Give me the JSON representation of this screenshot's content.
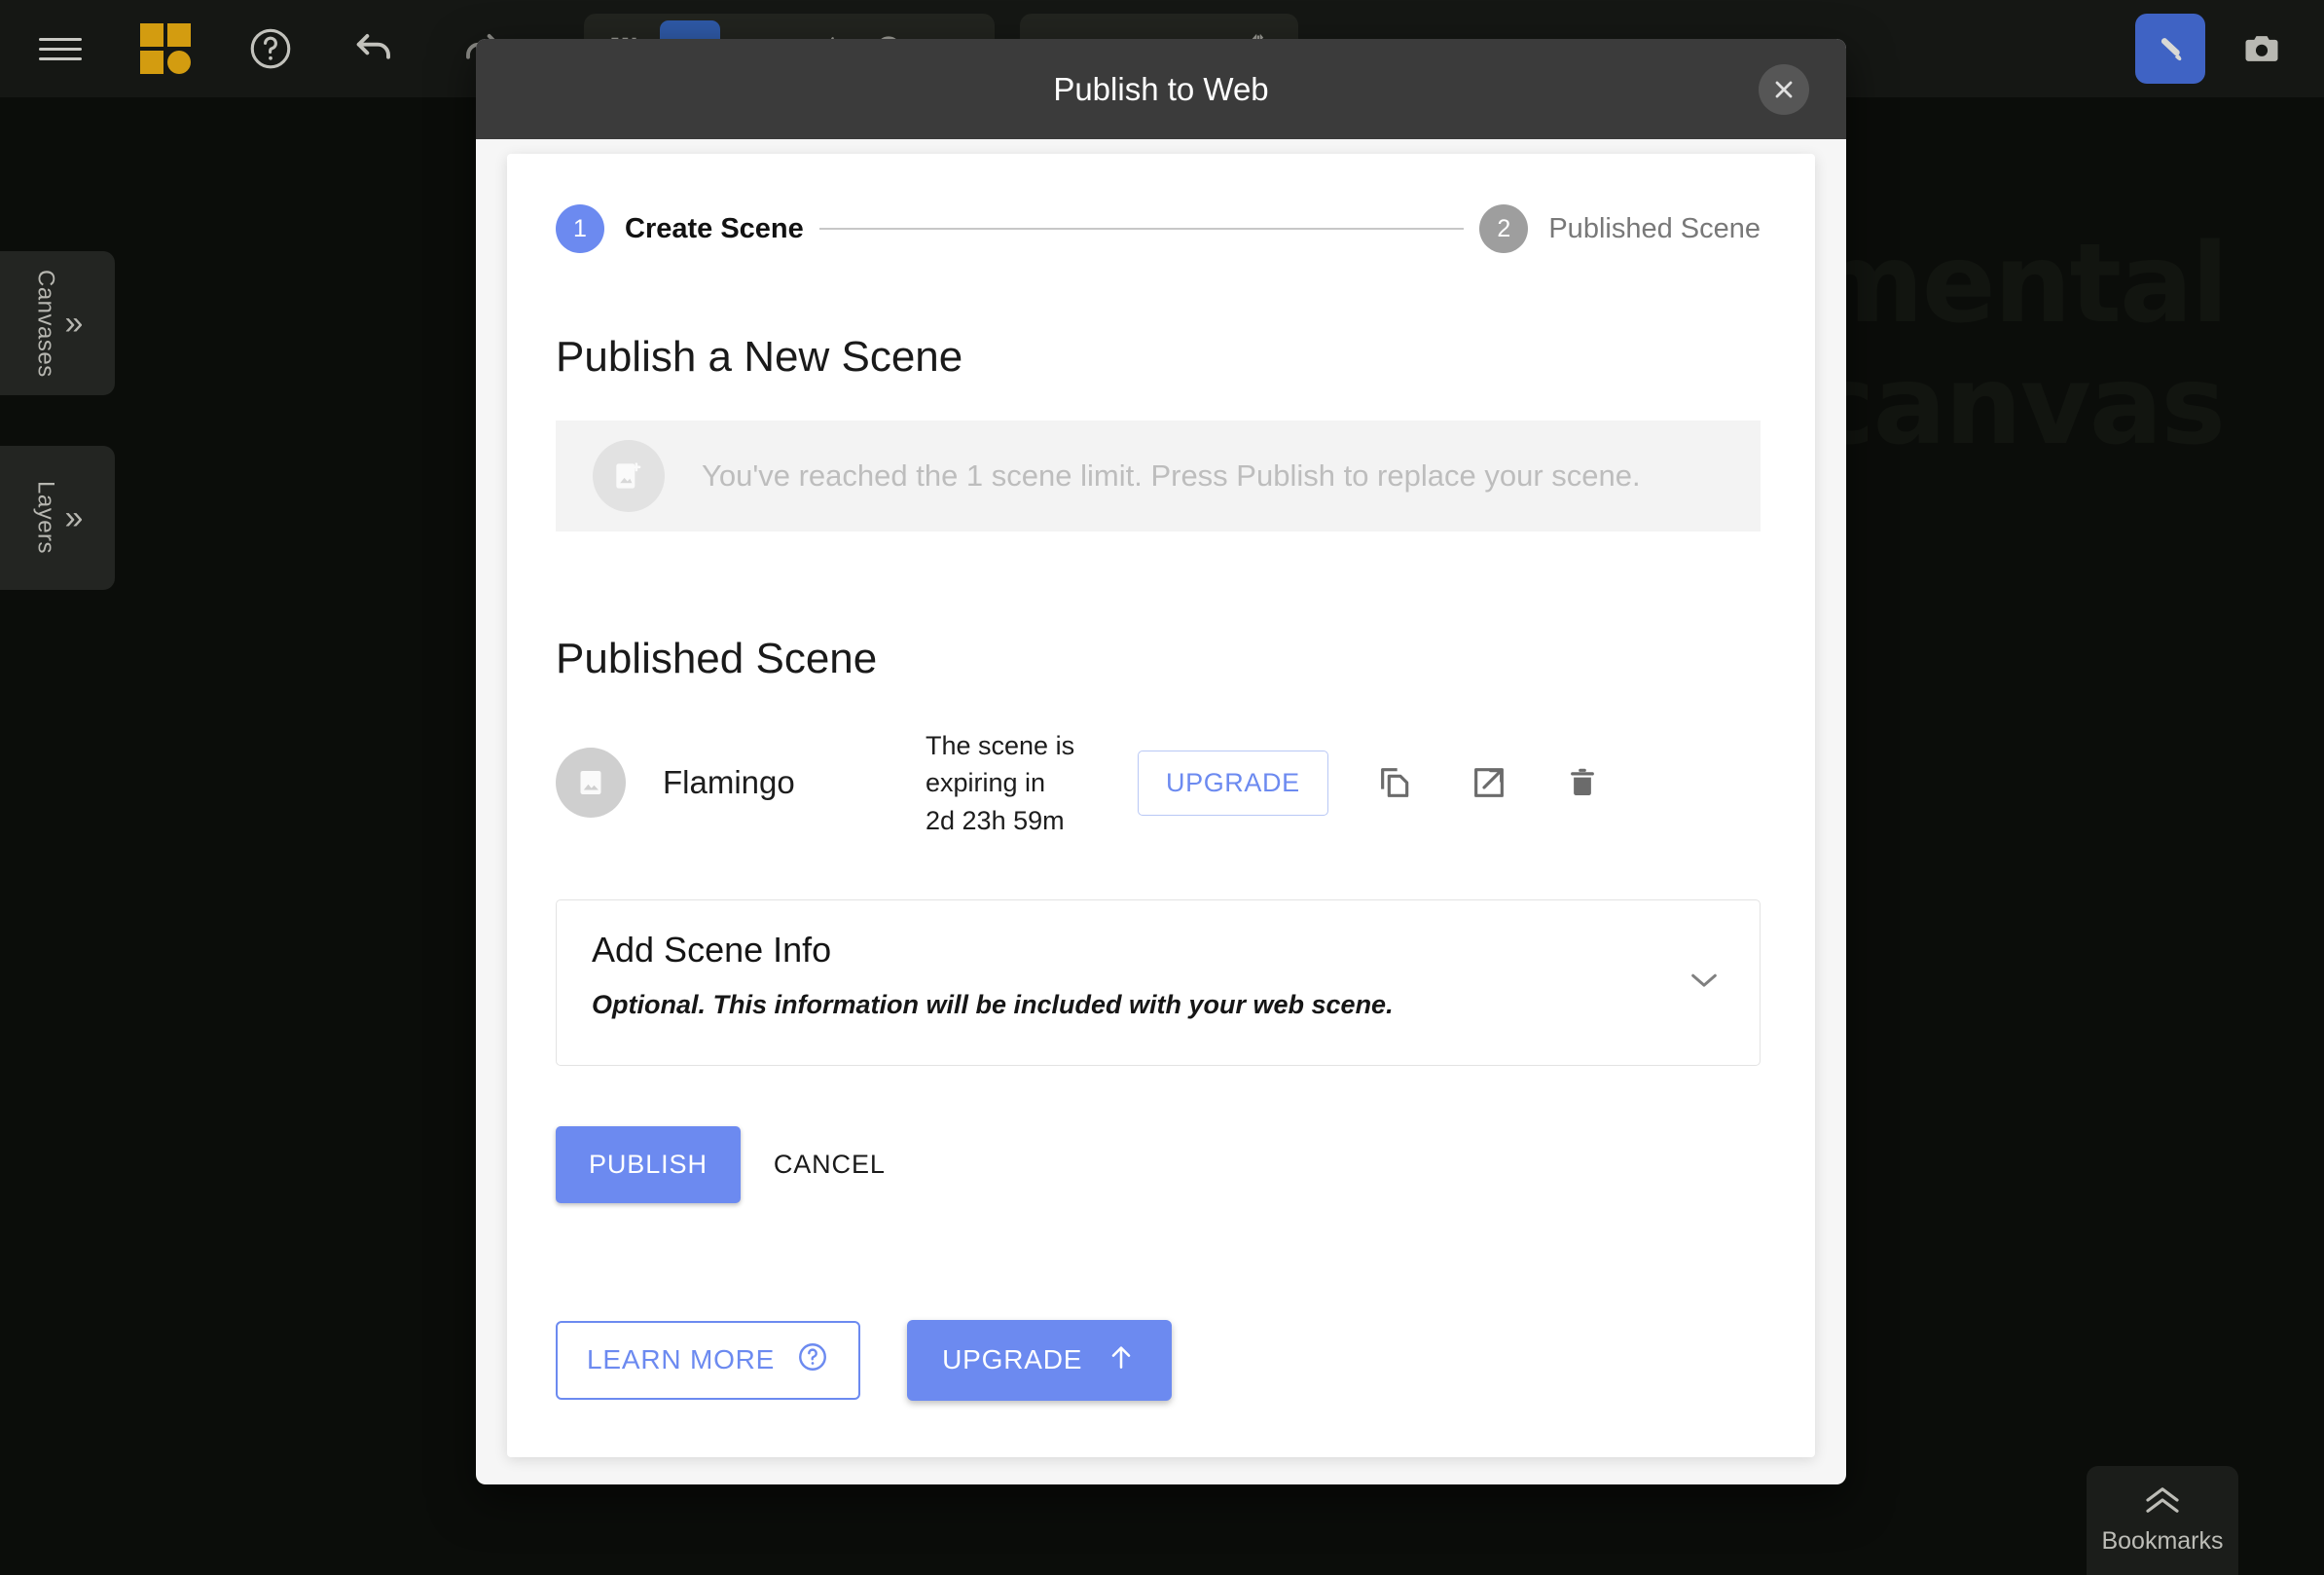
{
  "app": {
    "canvas_backdrop_lines": [
      "mental",
      "canvas"
    ]
  },
  "toolbar": {
    "menu_icon": "hamburger-menu-icon",
    "logo_icon": "mental-canvas-logo-icon",
    "help_icon": "help-circle-icon",
    "undo_icon": "undo-arrow-icon",
    "redo_icon": "redo-arrow-icon",
    "tools": [
      {
        "name": "select-tool",
        "icon": "dashed-rect-icon",
        "active": false
      },
      {
        "name": "draw-tool",
        "icon": "scribble-icon",
        "active": true
      },
      {
        "name": "fill-tool",
        "icon": "triangle-fill-icon",
        "active": false
      },
      {
        "name": "polyline-tool",
        "icon": "polyline-icon",
        "active": false
      },
      {
        "name": "lasso-tool",
        "icon": "circle-outline-icon",
        "active": false
      },
      {
        "name": "frame-tool",
        "icon": "rounded-rect-icon",
        "active": false
      }
    ],
    "tools_right": [
      {
        "name": "canvas-tool",
        "icon": "rect-icon",
        "active": false
      },
      {
        "name": "transform-tool",
        "icon": "axis-icon",
        "active": false
      },
      {
        "name": "crop-tool",
        "icon": "rect-outline-icon",
        "active": false
      },
      {
        "name": "mirror-tool",
        "icon": "mirror-flip-icon",
        "active": false
      }
    ],
    "brush_button_icon": "paintbrush-icon",
    "camera_button_icon": "camera-icon"
  },
  "side_tabs": [
    {
      "label": "Canvases",
      "icon": "double-chevron-right-icon"
    },
    {
      "label": "Layers",
      "icon": "double-chevron-right-icon"
    }
  ],
  "bookmarks": {
    "label": "Bookmarks",
    "icon": "double-chevron-up-icon"
  },
  "modal": {
    "title": "Publish to Web",
    "close_icon": "close-x-icon",
    "stepper": [
      {
        "number": "1",
        "label": "Create Scene",
        "state": "active"
      },
      {
        "number": "2",
        "label": "Published Scene",
        "state": "inactive"
      }
    ],
    "publish_section": {
      "heading": "Publish a New Scene",
      "notice_icon": "add-image-icon",
      "notice_text": "You've reached the 1 scene limit. Press Publish to replace your scene."
    },
    "published_section": {
      "heading": "Published Scene",
      "scene": {
        "thumbnail_icon": "image-placeholder-icon",
        "name": "Flamingo",
        "expiring_line1": "The scene is expiring in",
        "expiring_line2": "2d 23h 59m",
        "upgrade_label": "UPGRADE",
        "actions": [
          {
            "name": "copy-link-button",
            "icon": "copy-icon"
          },
          {
            "name": "open-external-button",
            "icon": "external-link-icon"
          },
          {
            "name": "delete-scene-button",
            "icon": "trash-icon"
          }
        ]
      }
    },
    "scene_info": {
      "title": "Add Scene Info",
      "subtitle": "Optional. This information will be included with your web scene.",
      "chevron_icon": "chevron-down-icon"
    },
    "actions": {
      "publish_label": "PUBLISH",
      "cancel_label": "CANCEL"
    },
    "footer": {
      "learn_more_label": "LEARN MORE",
      "learn_more_icon": "help-circle-icon",
      "upgrade_label": "UPGRADE",
      "upgrade_icon": "arrow-up-icon"
    }
  },
  "colors": {
    "accent_blue": "#6c8af0",
    "logo_gold": "#d39c10",
    "modal_header": "#3b3b3b",
    "tool_active": "#3f63c4"
  }
}
